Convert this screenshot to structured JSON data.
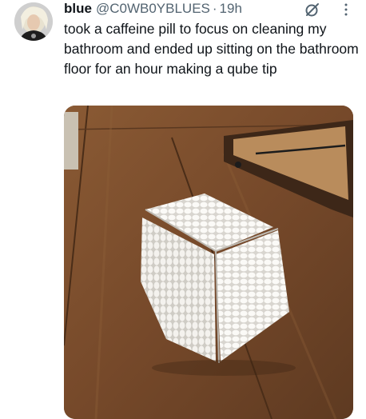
{
  "tweet": {
    "display_name": "blue",
    "handle": "@C0WB0YBLUES",
    "separator": "·",
    "timestamp": "19h",
    "text": "took a caffeine pill to focus on cleaning my bathroom and ended up sitting on the bathroom floor for an hour making a qube tip"
  },
  "icons": {
    "grok": "grok-icon",
    "more": "more-icon",
    "avatar": "avatar"
  },
  "colors": {
    "text_primary": "#0f1419",
    "text_secondary": "#536471"
  }
}
